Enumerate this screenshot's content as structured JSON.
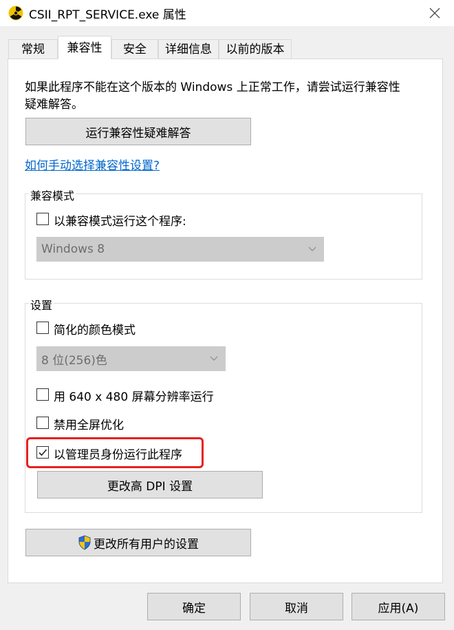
{
  "window": {
    "title": "CSII_RPT_SERVICE.exe 属性",
    "close_icon": "close-icon",
    "app_icon": "radiation-icon"
  },
  "tabs": [
    {
      "label": "常规",
      "active": false
    },
    {
      "label": "兼容性",
      "active": true
    },
    {
      "label": "安全",
      "active": false
    },
    {
      "label": "详细信息",
      "active": false
    },
    {
      "label": "以前的版本",
      "active": false
    }
  ],
  "compat": {
    "intro_line1": "如果此程序不能在这个版本的 Windows 上正常工作，请尝试运行兼容性",
    "intro_line2": "疑难解答。",
    "troubleshoot_button": "运行兼容性疑难解答",
    "manual_link": "如何手动选择兼容性设置?"
  },
  "compat_mode": {
    "legend": "兼容模式",
    "checkbox_label": "以兼容模式运行这个程序:",
    "checked": false,
    "select_value": "Windows 8"
  },
  "settings": {
    "legend": "设置",
    "reduced_color_label": "简化的颜色模式",
    "reduced_color_checked": false,
    "color_select_value": "8 位(256)色",
    "res_640_label": "用 640 x 480 屏幕分辨率运行",
    "res_640_checked": false,
    "fullscreen_opt_label": "禁用全屏优化",
    "fullscreen_opt_checked": false,
    "run_admin_label": "以管理员身份运行此程序",
    "run_admin_checked": true,
    "dpi_button": "更改高 DPI 设置"
  },
  "all_users_button": "更改所有用户的设置",
  "footer": {
    "ok": "确定",
    "cancel": "取消",
    "apply": "应用(A)"
  },
  "colors": {
    "highlight": "#e62020",
    "link": "#0066cc",
    "button_bg": "#e1e1e1"
  }
}
